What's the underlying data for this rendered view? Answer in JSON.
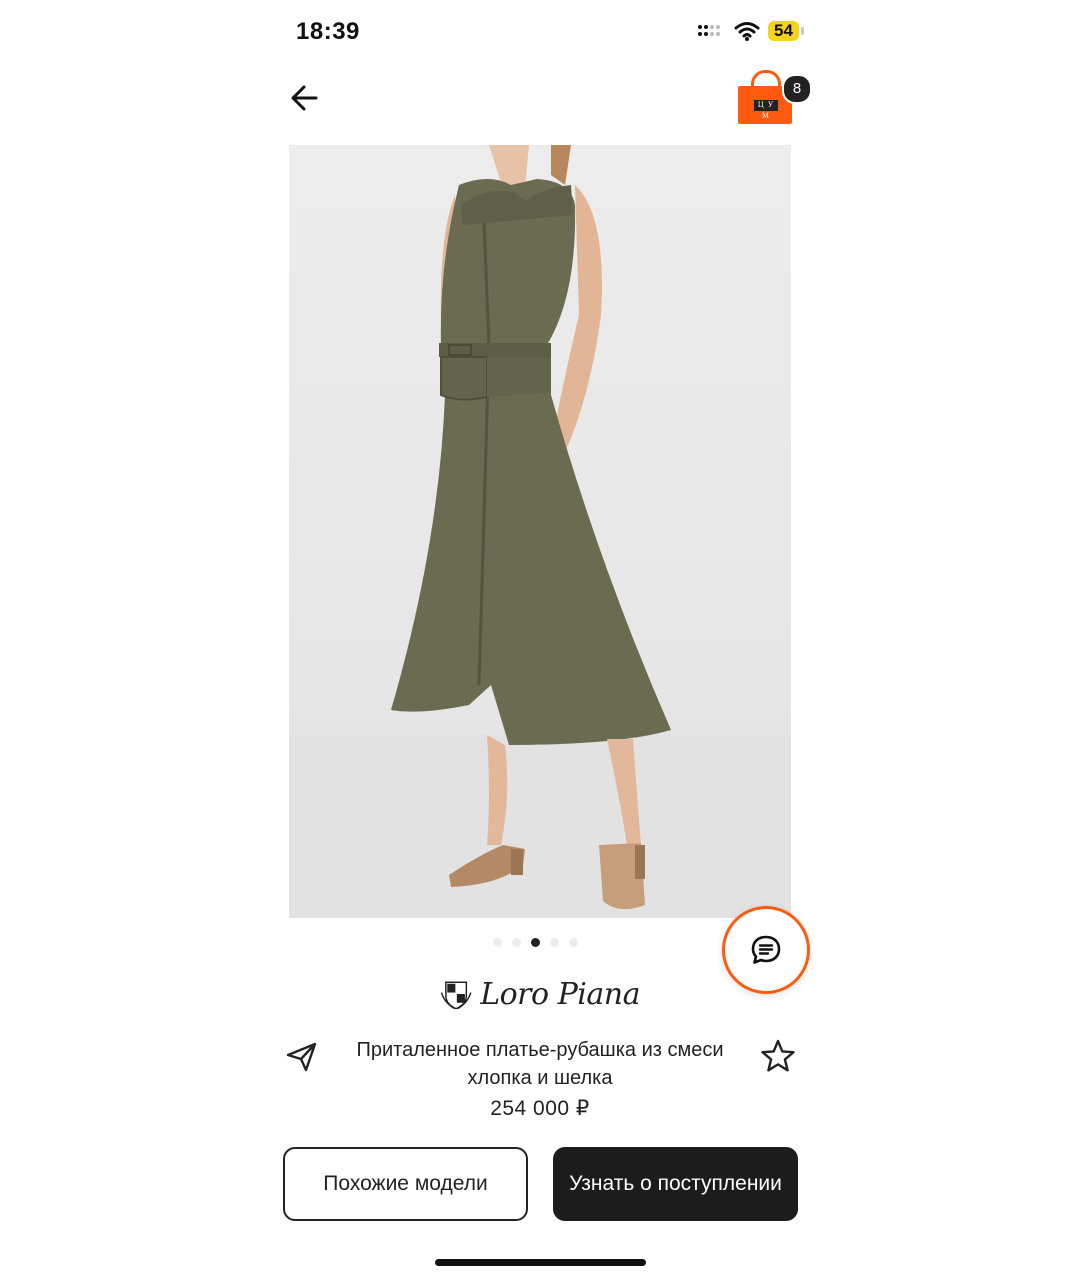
{
  "status_bar": {
    "time": "18:39",
    "battery_level": "54",
    "icons": [
      "signal-icon",
      "wifi-icon",
      "battery-icon"
    ]
  },
  "header": {
    "back_icon": "arrow-left-icon",
    "cart_icon": "shopping-bag-icon",
    "cart_logo_text": "Ц У М",
    "cart_count": "8",
    "cart_color": "#ff5a10"
  },
  "gallery": {
    "image_alt_icon": "product-photo",
    "dots_total": 5,
    "active_dot": 3
  },
  "chat": {
    "icon": "chat-bubble-icon",
    "accent": "#ff5a10"
  },
  "product": {
    "brand": "Loro Piana",
    "title": "Приталенное платье-рубашка из смеси хлопка и шелка",
    "price": "254 000 ₽",
    "share_icon": "paper-plane-icon",
    "favorite_icon": "star-icon"
  },
  "actions": {
    "similar_label": "Похожие модели",
    "notify_label": "Узнать о поступлении"
  }
}
